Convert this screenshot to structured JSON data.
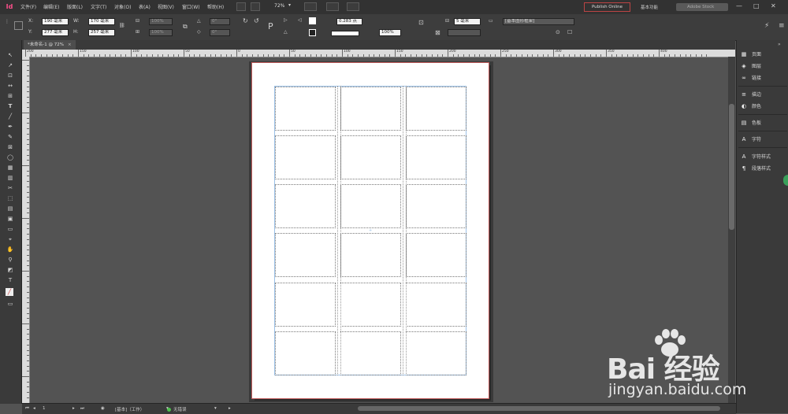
{
  "app": {
    "logo": "Id"
  },
  "menu": [
    "文件(F)",
    "编辑(E)",
    "版面(L)",
    "文字(T)",
    "对象(O)",
    "表(A)",
    "视图(V)",
    "窗口(W)",
    "帮助(H)"
  ],
  "zoom_display": "72%",
  "publish_label": "Publish Online",
  "workspace_label": "基本功能",
  "stock_placeholder": "Adobe Stock",
  "control": {
    "x_label": "X:",
    "x_value": "190 毫米",
    "y_label": "Y:",
    "y_value": "277 毫米",
    "w_label": "W:",
    "w_value": "170 毫米",
    "h_label": "H:",
    "h_value": "257 毫米",
    "scale_x": "100%",
    "scale_y": "100%",
    "rotate": "0°",
    "shear": "0°",
    "stroke_weight": "0.283 点",
    "opacity": "100%",
    "spacing": "5 毫米",
    "frame_style": "[基本图形框架]"
  },
  "doc_tab": {
    "title": "*未命名-1 @ 72%",
    "close": "×"
  },
  "ruler_labels": [
    "200",
    "150",
    "100",
    "50",
    "0",
    "50",
    "100",
    "150",
    "200",
    "250",
    "300",
    "350",
    "400"
  ],
  "panels": [
    {
      "label": "页面",
      "icon": "▦"
    },
    {
      "label": "图层",
      "icon": "◈"
    },
    {
      "label": "链接",
      "icon": "∞"
    },
    {
      "label": "描边",
      "icon": "≡"
    },
    {
      "label": "颜色",
      "icon": "◐"
    },
    {
      "label": "色板",
      "icon": "▤"
    },
    {
      "label": "字符",
      "icon": "A"
    },
    {
      "label": "字符样式",
      "icon": "A"
    },
    {
      "label": "段落样式",
      "icon": "¶"
    }
  ],
  "status": {
    "page_number": "1",
    "profile": "[基本]（工作）",
    "preflight": "无错误"
  },
  "watermark": {
    "main": "Bai 经验",
    "sub": "jingyan.baidu.com"
  },
  "colors": {
    "accent": "#ff4f8b",
    "publish_border": "#bb4444",
    "guide": "#9bc1e8",
    "ok": "#4ec14e"
  }
}
